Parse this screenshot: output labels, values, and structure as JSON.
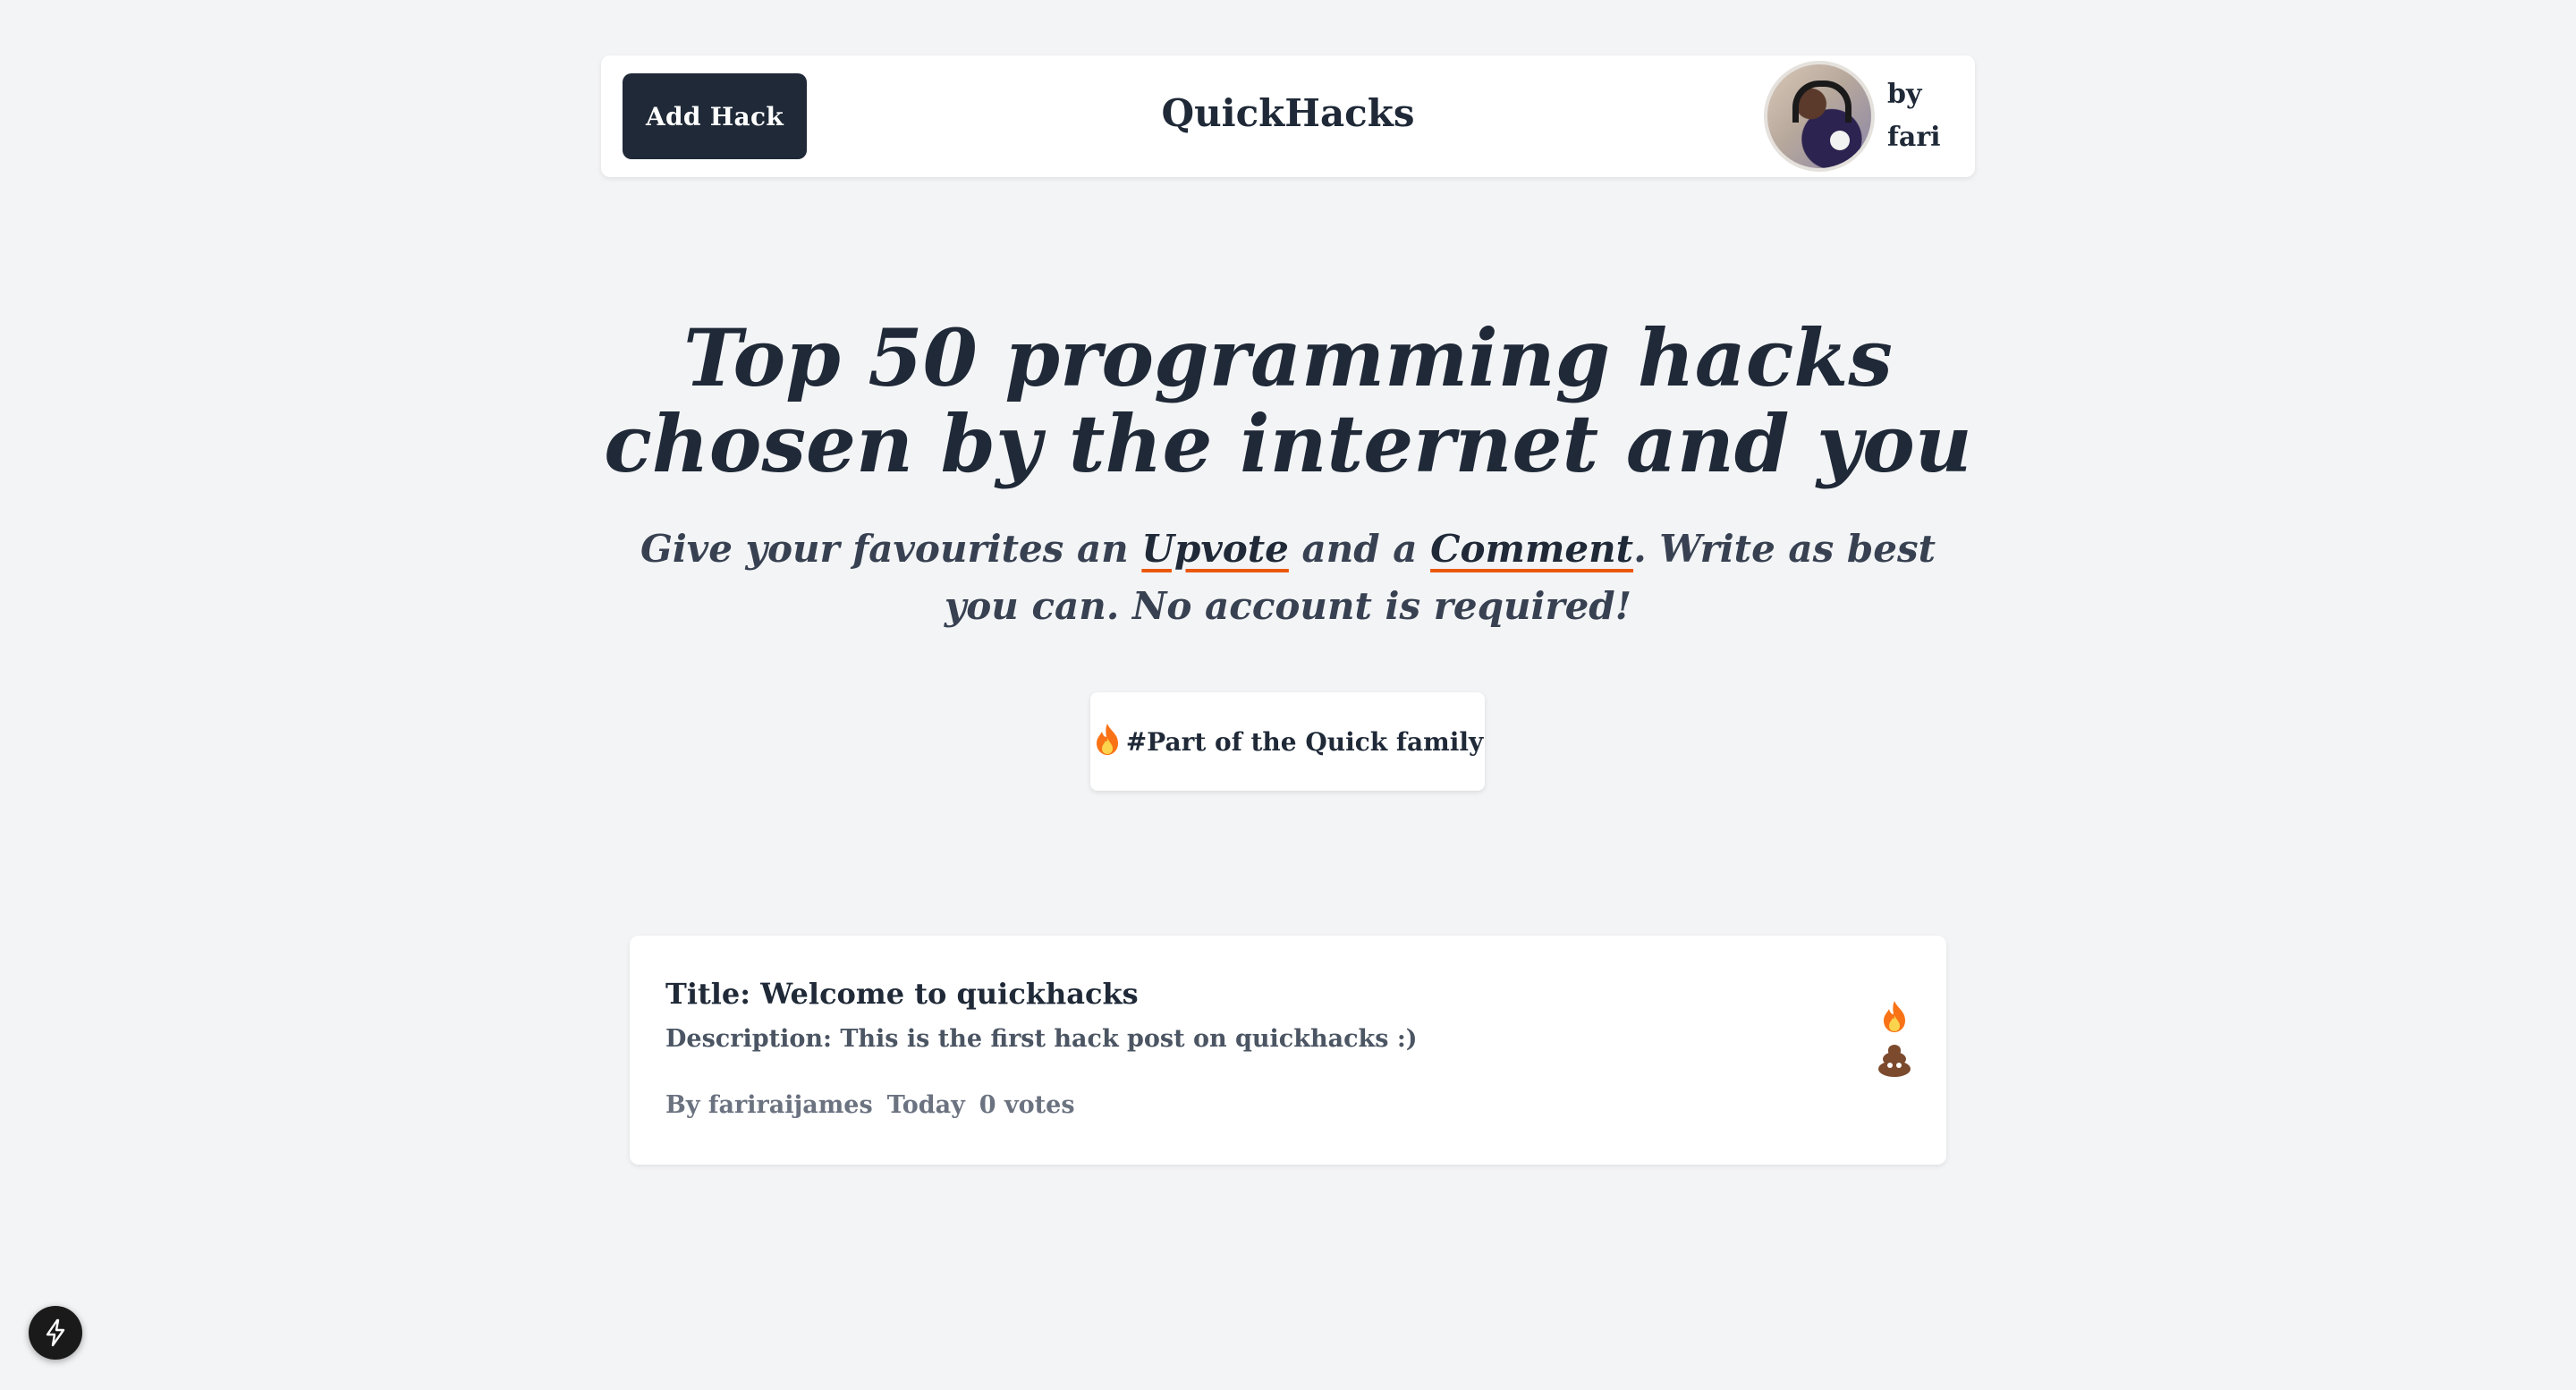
{
  "header": {
    "add_button_label": "Add Hack",
    "brand": "QuickHacks",
    "author_by": "by",
    "author_name": "fari"
  },
  "hero": {
    "title": "Top 50 programming hacks chosen by the internet and you",
    "subtitle_part1": "Give your favourites an ",
    "upvote_link": "Upvote",
    "subtitle_part2": " and a ",
    "comment_link": "Comment",
    "subtitle_part3": ". Write as best you can. No account is required!",
    "family_chip_label": "#Part of the Quick family"
  },
  "hacks": [
    {
      "title": "Title: Welcome to quickhacks",
      "description": "Description: This is the first hack post on quickhacks :)",
      "author": "By fariraijames",
      "date": "Today",
      "votes": "0 votes"
    }
  ],
  "colors": {
    "background": "#f3f4f6",
    "primary_dark": "#1f2937",
    "accent_underline": "#ea580c"
  },
  "icons": {
    "chip": "fire-icon",
    "upvote": "fire-icon",
    "downvote": "poo-icon",
    "floating": "lightning-bolt-icon"
  }
}
